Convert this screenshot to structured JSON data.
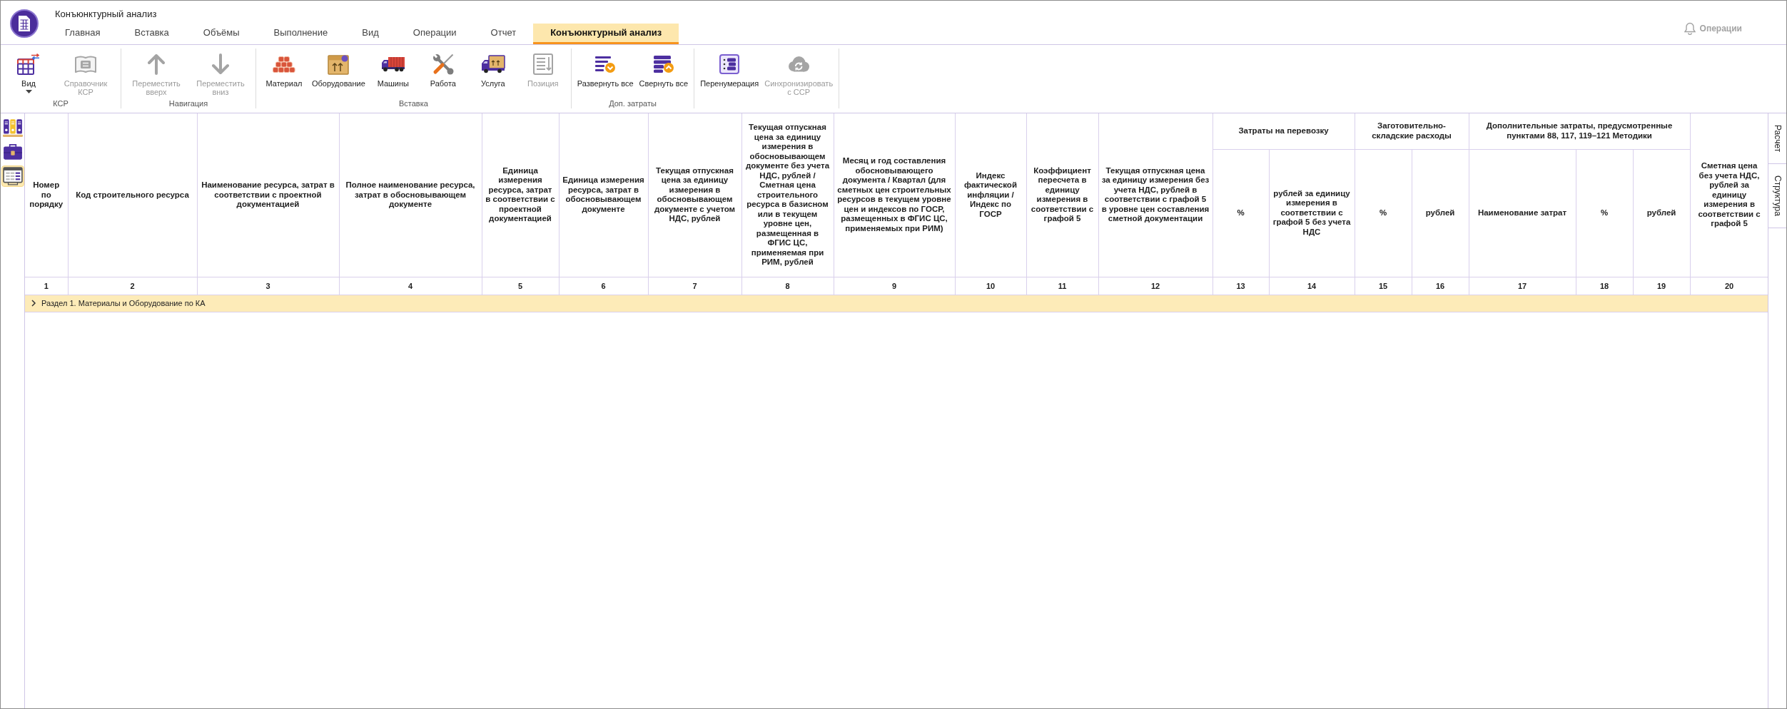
{
  "app": {
    "title": "Конъюнктурный анализ"
  },
  "tabs": [
    {
      "label": "Главная",
      "selected": false
    },
    {
      "label": "Вставка",
      "selected": false
    },
    {
      "label": "Объёмы",
      "selected": false
    },
    {
      "label": "Выполнение",
      "selected": false
    },
    {
      "label": "Вид",
      "selected": false
    },
    {
      "label": "Операции",
      "selected": false
    },
    {
      "label": "Отчет",
      "selected": false
    },
    {
      "label": "Конъюнктурный анализ",
      "selected": true
    }
  ],
  "notifications": {
    "label": "Операции",
    "disabled": true
  },
  "ribbon": {
    "groups": [
      {
        "label": "КСР",
        "buttons": [
          {
            "kind": "view",
            "label": "Вид",
            "disabled": false
          },
          {
            "kind": "catalog",
            "label": "Справочник КСР",
            "disabled": true
          }
        ]
      },
      {
        "label": "Навигация",
        "buttons": [
          {
            "kind": "up",
            "label": "Переместить вверх",
            "disabled": true
          },
          {
            "kind": "down",
            "label": "Переместить вниз",
            "disabled": true
          }
        ]
      },
      {
        "label": "Вставка",
        "buttons": [
          {
            "kind": "material",
            "label": "Материал",
            "disabled": false
          },
          {
            "kind": "equipment",
            "label": "Оборудование",
            "disabled": false
          },
          {
            "kind": "machines",
            "label": "Машины",
            "disabled": false
          },
          {
            "kind": "work",
            "label": "Работа",
            "disabled": false
          },
          {
            "kind": "service",
            "label": "Услуга",
            "disabled": false
          },
          {
            "kind": "position",
            "label": "Позиция",
            "disabled": true
          }
        ]
      },
      {
        "label": "Доп. затраты",
        "buttons": [
          {
            "kind": "expand",
            "label": "Развернуть все",
            "disabled": false
          },
          {
            "kind": "collapse",
            "label": "Свернуть все",
            "disabled": false
          }
        ]
      },
      {
        "buttons": [
          {
            "kind": "renumber",
            "label": "Перенумерация",
            "disabled": false
          },
          {
            "kind": "sync",
            "label": "Синхронизировать с ССР",
            "disabled": true
          }
        ]
      }
    ]
  },
  "side_tools": [
    {
      "kind": "binders",
      "selected": false
    },
    {
      "kind": "briefcase",
      "selected": false
    },
    {
      "kind": "form",
      "selected": true
    }
  ],
  "table": {
    "columns": [
      {
        "kind": "single",
        "header": "Номер по порядку",
        "number": "1"
      },
      {
        "kind": "single",
        "header": "Код строительного ресурса",
        "number": "2"
      },
      {
        "kind": "single",
        "header": "Наименование ресурса, затрат в соответствии с проектной документацией",
        "number": "3"
      },
      {
        "kind": "single",
        "header": "Полное наименование ресурса, затрат в обосновывающем документе",
        "number": "4"
      },
      {
        "kind": "single",
        "header": "Единица измерения ресурса, затрат в соответствии с проектной документацией",
        "number": "5"
      },
      {
        "kind": "single",
        "header": "Единица измерения ресурса, затрат в обосновывающем документе",
        "number": "6"
      },
      {
        "kind": "single",
        "header": "Текущая отпускная цена за единицу измерения в обосновывающем документе с учетом НДС, рублей",
        "number": "7"
      },
      {
        "kind": "single",
        "header": "Текущая отпускная цена за единицу измерения в обосновывающем документе без учета НДС, рублей / Сметная цена строительного ресурса в базисном или в текущем уровне цен, размещенная в ФГИС ЦС, применяемая при РИМ, рублей",
        "number": "8"
      },
      {
        "kind": "single",
        "header": "Месяц и год составления обосновывающего документа / Квартал (для сметных цен строительных ресурсов в текущем уровне цен и индексов по ГОСР, размещенных в ФГИС ЦС, применяемых при РИМ)",
        "number": "9"
      },
      {
        "kind": "single",
        "header": "Индекс фактической инфляции / Индекс по ГОСР",
        "number": "10"
      },
      {
        "kind": "single",
        "header": "Коэффициент пересчета в единицу измерения в соответствии с графой 5",
        "number": "11"
      },
      {
        "kind": "single",
        "header": "Текущая отпускная цена за единицу измерения без учета НДС, рублей в соответствии с графой 5 в уровне цен составления сметной документации",
        "number": "12"
      },
      {
        "kind": "group",
        "header": "Затраты на перевозку",
        "columns": [
          {
            "header": "%",
            "number": "13"
          },
          {
            "header": "рублей за единицу измерения в соответствии с графой 5 без учета НДС",
            "number": "14"
          }
        ]
      },
      {
        "kind": "group",
        "header": "Заготовительно-складские расходы",
        "columns": [
          {
            "header": "%",
            "number": "15"
          },
          {
            "header": "рублей",
            "number": "16"
          }
        ]
      },
      {
        "kind": "group",
        "header": "Дополнительные затраты, предусмотренные пунктами 88, 117, 119–121 Методики",
        "columns": [
          {
            "header": "Наименование затрат",
            "number": "17"
          },
          {
            "header": "%",
            "number": "18"
          },
          {
            "header": "рублей",
            "number": "19"
          }
        ]
      },
      {
        "kind": "single",
        "header": "Сметная цена без учета НДС, рублей за единицу измерения в соответствии с графой 5",
        "number": "20"
      }
    ],
    "sections": [
      {
        "title": "Раздел 1. Материалы и Оборудование по КА",
        "expanded": false
      }
    ]
  },
  "side_tabs": [
    {
      "label": "Расчет",
      "selected": false
    },
    {
      "label": "Структура",
      "selected": false
    }
  ]
}
